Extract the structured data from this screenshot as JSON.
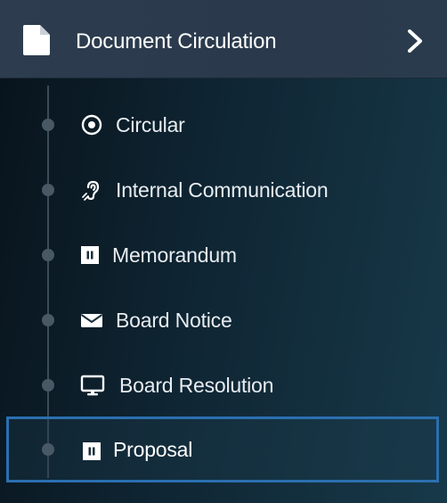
{
  "header": {
    "title": "Document Circulation",
    "icon": "document-icon",
    "expand_icon": "chevron-right-icon"
  },
  "menu": {
    "items": [
      {
        "label": "Circular",
        "icon": "radio-target-icon"
      },
      {
        "label": "Internal Communication",
        "icon": "hearing-icon"
      },
      {
        "label": "Memorandum",
        "icon": "pause-square-icon"
      },
      {
        "label": "Board Notice",
        "icon": "envelope-icon"
      },
      {
        "label": "Board Resolution",
        "icon": "monitor-icon"
      },
      {
        "label": "Proposal",
        "icon": "pause-square-icon",
        "selected": true
      }
    ]
  },
  "colors": {
    "header_bg": "#2d3d4f",
    "sidebar_bg": "#0f2533",
    "selection_border": "#2b6fb0",
    "tree_line": "#3d4b57"
  }
}
